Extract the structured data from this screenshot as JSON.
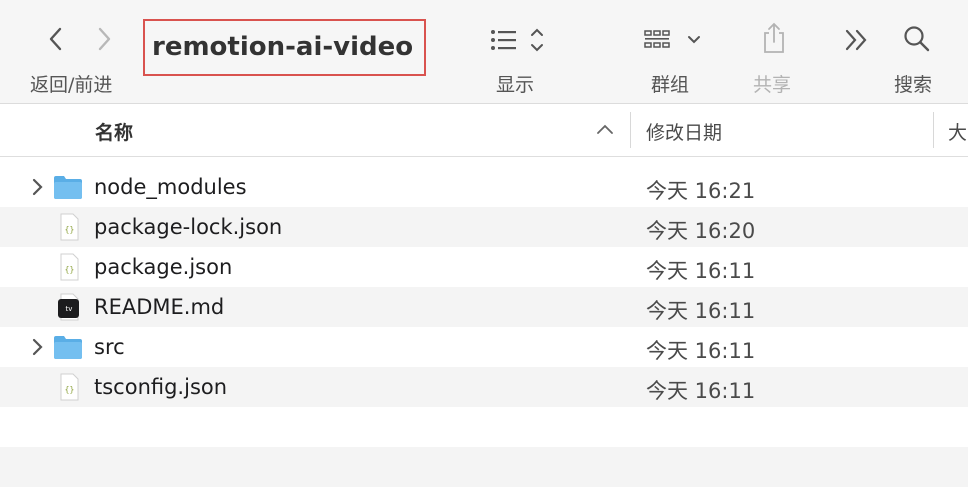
{
  "toolbar": {
    "nav_label": "返回/前进",
    "title": "remotion-ai-video",
    "view_label": "显示",
    "group_label": "群组",
    "share_label": "共享",
    "search_label": "搜索"
  },
  "columns": {
    "name": "名称",
    "modified": "修改日期",
    "size": "大"
  },
  "files": [
    {
      "name": "node_modules",
      "date": "今天 16:21",
      "kind": "folder"
    },
    {
      "name": "package-lock.json",
      "date": "今天 16:20",
      "kind": "json"
    },
    {
      "name": "package.json",
      "date": "今天 16:11",
      "kind": "json"
    },
    {
      "name": "README.md",
      "date": "今天 16:11",
      "kind": "md"
    },
    {
      "name": "src",
      "date": "今天 16:11",
      "kind": "folder"
    },
    {
      "name": "tsconfig.json",
      "date": "今天 16:11",
      "kind": "json"
    }
  ],
  "json_icon_glyph": "{}",
  "md_icon_glyph": "tv",
  "colors": {
    "folder": "#5aaee6",
    "highlight_box": "#d9534f",
    "alt_row": "#f4f4f4"
  }
}
